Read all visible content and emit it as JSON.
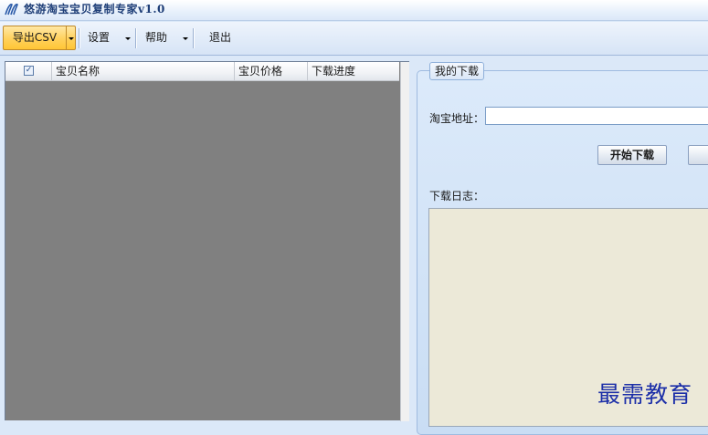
{
  "app": {
    "title": "悠游淘宝宝贝复制专家v1.0"
  },
  "toolbar": {
    "export_label": "导出CSV",
    "settings_label": "设置",
    "help_label": "帮助",
    "exit_label": "退出"
  },
  "list": {
    "columns": [
      "",
      "宝贝名称",
      "宝贝价格",
      "下载进度"
    ],
    "select_all_checked": true,
    "rows": []
  },
  "panel": {
    "group_title": "我的下载",
    "url_label": "淘宝地址：",
    "url_value": "",
    "start_button_label": "开始下载",
    "log_label": "下载日志：",
    "log_text": ""
  },
  "watermark": "最需教育",
  "colors": {
    "accent_button": "#ffd15c",
    "list_background": "#808080",
    "log_background": "#ece9d8",
    "watermark": "#1c2fa8"
  }
}
